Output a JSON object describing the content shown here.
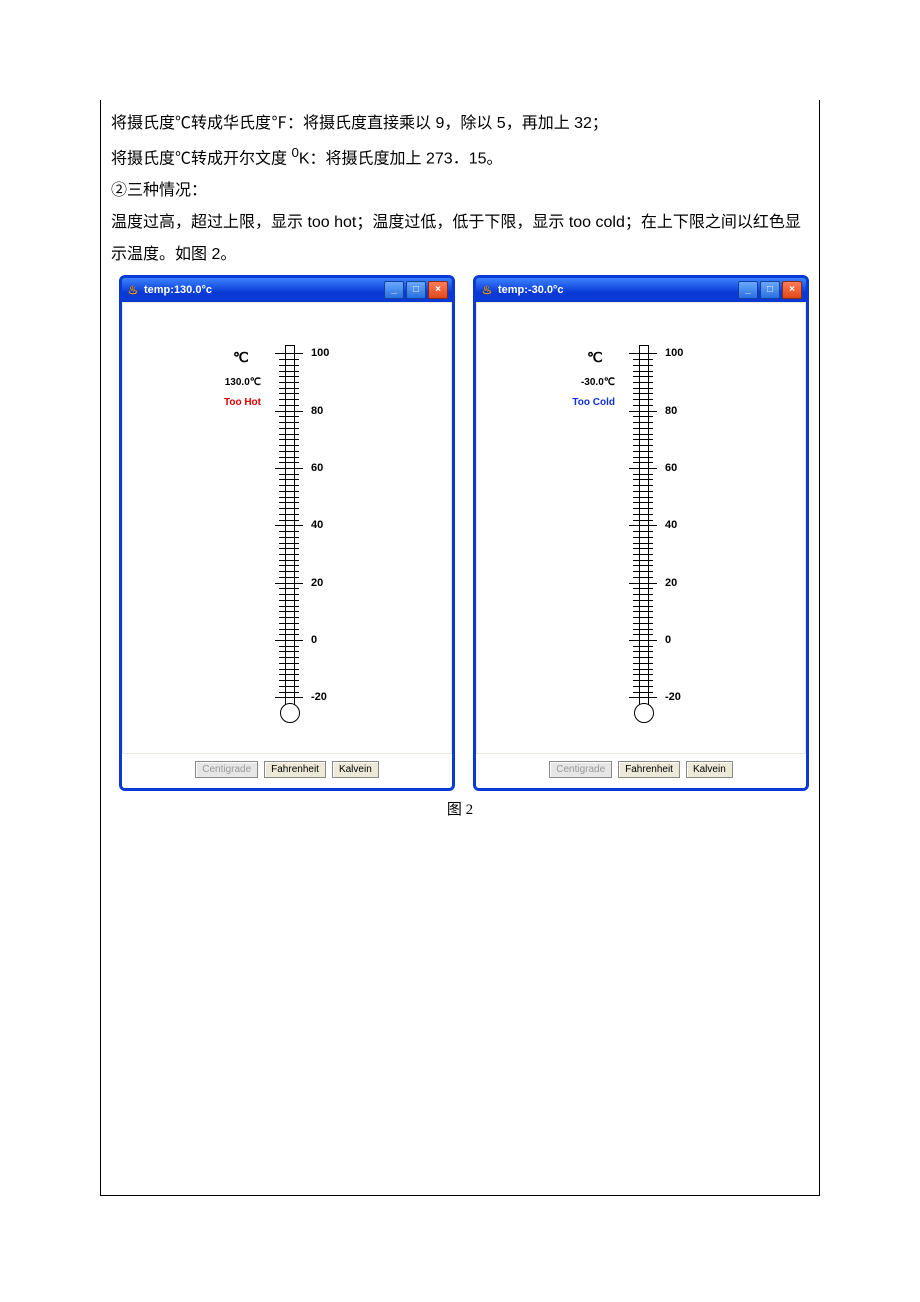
{
  "text": {
    "p1": "将摄氏度℃转成华氏度℉：将摄氏度直接乘以 9，除以 5，再加上 32；",
    "p2_a": "将摄氏度℃转成开尔文度 ",
    "p2_sup": "0",
    "p2_b": "K：将摄氏度加上 273．15。",
    "p3": "②三种情况：",
    "p4": "温度过高，超过上限，显示 too hot；温度过低，低于下限，显示 too cold；在上下限之间以红色显示温度。如图 2。",
    "caption": "图 2"
  },
  "left": {
    "title": "temp:130.0°c",
    "unit": "℃",
    "value": "130.0℃",
    "status": "Too Hot",
    "status_class": "hot"
  },
  "right": {
    "title": "temp:-30.0°c",
    "unit": "℃",
    "value": "-30.0℃",
    "status": "Too Cold",
    "status_class": "cold"
  },
  "buttons": {
    "centigrade": "Centigrade",
    "fahrenheit": "Fahrenheit",
    "kalvein": "Kalvein"
  },
  "scale": {
    "labels": [
      "100",
      "80",
      "60",
      "40",
      "20",
      "0",
      "-20"
    ]
  }
}
